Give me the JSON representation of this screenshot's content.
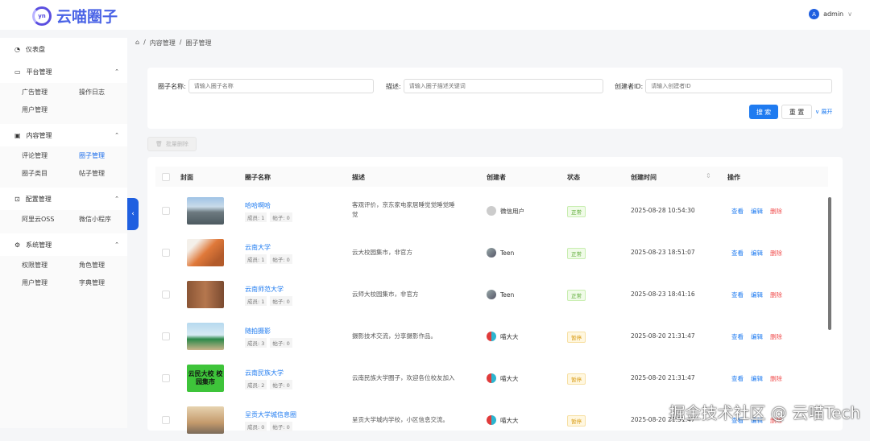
{
  "app": {
    "title": "云喵圈子",
    "logo_mark": "yn"
  },
  "user": {
    "initial": "A",
    "name": "admin"
  },
  "sidebar": {
    "dashboard": "仪表盘",
    "groups": [
      {
        "label": "平台管理",
        "items": [
          "广告管理",
          "操作日志",
          "用户管理"
        ]
      },
      {
        "label": "内容管理",
        "items": [
          "评论管理",
          "圈子管理",
          "圈子类目",
          "帖子管理"
        ],
        "active": "圈子管理"
      },
      {
        "label": "配置管理",
        "items": [
          "阿里云OSS",
          "微信小程序"
        ]
      },
      {
        "label": "系统管理",
        "items": [
          "权限管理",
          "角色管理",
          "用户管理",
          "字典管理"
        ]
      }
    ]
  },
  "breadcrumb": [
    "内容管理",
    "圈子管理"
  ],
  "search": {
    "name_label": "圈子名称:",
    "name_placeholder": "请输入圈子名称",
    "desc_label": "描述:",
    "desc_placeholder": "请输入圈子描述关键词",
    "creator_label": "创建者ID:",
    "creator_placeholder": "请输入创建者ID",
    "search_btn": "搜 索",
    "reset_btn": "重 置",
    "expand": "展开"
  },
  "batch_delete": "批量删除",
  "table": {
    "headers": [
      "封面",
      "圈子名称",
      "描述",
      "创建者",
      "状态",
      "创建时间",
      "操作"
    ],
    "actions": {
      "view": "查看",
      "edit": "编辑",
      "delete": "删除"
    },
    "rows": [
      {
        "name": "哈哈啊哈",
        "members": "成员: 1",
        "posts": "帖子: 0",
        "desc": "客观评价，京东家电家居睡觉觉睡觉睡觉",
        "creator": "微信用户",
        "status": "正常",
        "time": "2025-08-28 10:54:30"
      },
      {
        "name": "云南大学",
        "members": "成员: 1",
        "posts": "帖子: 0",
        "desc": "云大校园集市，非官方",
        "creator": "Teen",
        "status": "正常",
        "time": "2025-08-23 18:51:07"
      },
      {
        "name": "云南师范大学",
        "members": "成员: 1",
        "posts": "帖子: 0",
        "desc": "云师大校园集市，非官方",
        "creator": "Teen",
        "status": "正常",
        "time": "2025-08-23 18:41:16"
      },
      {
        "name": "随拍摄影",
        "members": "成员: 3",
        "posts": "帖子: 0",
        "desc": "摄影技术交流，分享摄影作品。",
        "creator": "喵大大",
        "status": "暂停",
        "time": "2025-08-20 21:31:47"
      },
      {
        "name": "云南民族大学",
        "members": "成员: 2",
        "posts": "帖子: 0",
        "desc": "云南民族大学圈子，欢迎各位校友加入",
        "creator": "喵大大",
        "status": "暂停",
        "time": "2025-08-20 21:31:47",
        "cover_text": "云民大校 校园集市"
      },
      {
        "name": "呈贡大学城信息圈",
        "members": "成员: 0",
        "posts": "帖子: 0",
        "desc": "呈贡大学城内学校，小区信息交流。",
        "creator": "喵大大",
        "status": "暂停",
        "time": "2025-08-20 21:31:47"
      }
    ]
  },
  "watermark": "掘金技术社区 @ 云喵Tech"
}
